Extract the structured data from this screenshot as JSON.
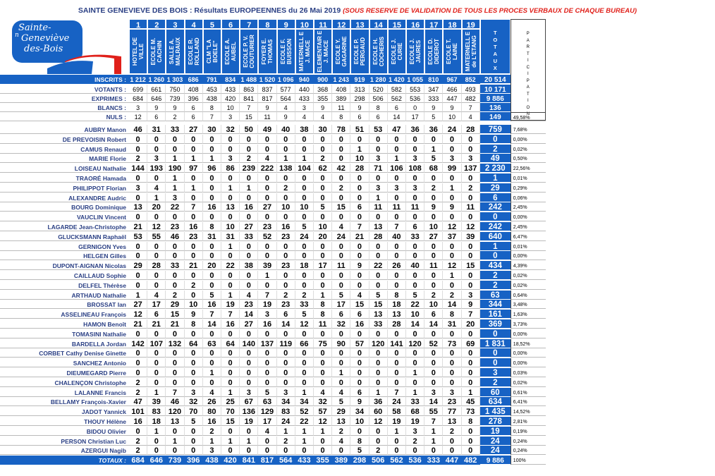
{
  "header": {
    "title_main": "SAINTE GENEVIEVE DES BOIS : Résultats EUROPEENNES du 26 Mai 2019",
    "title_note": "(SOUS RESERVE DE VALIDATION DE TOUS LES PROCES VERBAUX DE CHAQUE BUREAU)"
  },
  "logo": {
    "line1": "Sainte-",
    "line2": "Geneviève",
    "line3": "des-Bois",
    "prefix": "n"
  },
  "bureaux": [
    {
      "num": "1",
      "name": "HOTEL DE VILLE"
    },
    {
      "num": "2",
      "name": "ECOLE M. CACHIN"
    },
    {
      "num": "3",
      "name": "SALLE A. MALRAUX"
    },
    {
      "num": "4",
      "name": "ECOLE R. ROLLAND"
    },
    {
      "num": "5",
      "name": "CLM \"LA BOELE\""
    },
    {
      "num": "6",
      "name": "ECOLE A. AUBEL"
    },
    {
      "num": "7",
      "name": "ECOLE P. V. COUTURIER"
    },
    {
      "num": "8",
      "name": "FOYER E. THOMAS"
    },
    {
      "num": "9",
      "name": "ECOLE F. BUISSON"
    },
    {
      "num": "10",
      "name": "MATERNELL E J. MACE"
    },
    {
      "num": "11",
      "name": "ELEMENTAIR E J. MACE"
    },
    {
      "num": "12",
      "name": "ECOLE Y. GAGARINE"
    },
    {
      "num": "13",
      "name": "ECOLE P. PERGAUD"
    },
    {
      "num": "14",
      "name": "ECOLE H. COCHERIS"
    },
    {
      "num": "15",
      "name": "ECOLE J. CURIE"
    },
    {
      "num": "16",
      "name": "ECOLE J. JAURES"
    },
    {
      "num": "17",
      "name": "ECOLE D. DIDEROT"
    },
    {
      "num": "18",
      "name": "ECOLE T. LAINE"
    },
    {
      "num": "19",
      "name": "MATERNELL E de L'ETANG"
    }
  ],
  "totaux_header": "TOTAUX",
  "participation_header": "PARTICIPATION",
  "participation_value": "49,58%",
  "stats": [
    {
      "label": "INSCRITS :",
      "values": [
        "1 212",
        "1 260",
        "1 303",
        "686",
        "791",
        "834",
        "1 488",
        "1 520",
        "1 096",
        "940",
        "900",
        "1 243",
        "919",
        "1 280",
        "1 420",
        "1 055",
        "810",
        "967",
        "852"
      ],
      "total": "20 514"
    },
    {
      "label": "VOTANTS :",
      "values": [
        "699",
        "661",
        "750",
        "408",
        "453",
        "433",
        "863",
        "837",
        "577",
        "440",
        "368",
        "408",
        "313",
        "520",
        "582",
        "553",
        "347",
        "466",
        "493"
      ],
      "total": "10 171"
    },
    {
      "label": "EXPRIMES :",
      "values": [
        "684",
        "646",
        "739",
        "396",
        "438",
        "420",
        "841",
        "817",
        "564",
        "433",
        "355",
        "389",
        "298",
        "506",
        "562",
        "536",
        "333",
        "447",
        "482"
      ],
      "total": "9 886"
    },
    {
      "label": "BLANCS :",
      "values": [
        "3",
        "9",
        "9",
        "6",
        "8",
        "10",
        "7",
        "9",
        "4",
        "3",
        "9",
        "11",
        "9",
        "8",
        "6",
        "0",
        "9",
        "9",
        "7"
      ],
      "total": "136"
    },
    {
      "label": "NULS :",
      "values": [
        "12",
        "6",
        "2",
        "6",
        "7",
        "3",
        "15",
        "11",
        "9",
        "4",
        "4",
        "8",
        "6",
        "6",
        "14",
        "17",
        "5",
        "10",
        "4"
      ],
      "total": "149"
    }
  ],
  "candidates": [
    {
      "name": "AUBRY Manon",
      "values": [
        "46",
        "31",
        "33",
        "27",
        "30",
        "32",
        "50",
        "49",
        "40",
        "38",
        "30",
        "78",
        "51",
        "53",
        "47",
        "36",
        "36",
        "24",
        "28"
      ],
      "total": "759",
      "pct": "7,68%"
    },
    {
      "name": "DE PREVOISIN Robert",
      "values": [
        "0",
        "0",
        "0",
        "0",
        "0",
        "0",
        "0",
        "0",
        "0",
        "0",
        "0",
        "0",
        "0",
        "0",
        "0",
        "0",
        "0",
        "0",
        "0"
      ],
      "total": "0",
      "pct": "0,00%"
    },
    {
      "name": "CAMUS Renaud",
      "values": [
        "0",
        "0",
        "0",
        "0",
        "0",
        "0",
        "0",
        "0",
        "0",
        "0",
        "0",
        "0",
        "1",
        "0",
        "0",
        "0",
        "1",
        "0",
        "0"
      ],
      "total": "2",
      "pct": "0,02%"
    },
    {
      "name": "MARIE Florie",
      "values": [
        "2",
        "3",
        "1",
        "1",
        "1",
        "3",
        "2",
        "4",
        "1",
        "1",
        "2",
        "0",
        "10",
        "3",
        "1",
        "3",
        "5",
        "3",
        "3"
      ],
      "total": "49",
      "pct": "0,50%"
    },
    {
      "name": "LOISEAU Nathalie",
      "values": [
        "144",
        "193",
        "190",
        "97",
        "96",
        "86",
        "239",
        "222",
        "138",
        "104",
        "62",
        "42",
        "28",
        "71",
        "106",
        "108",
        "68",
        "99",
        "137"
      ],
      "total": "2 230",
      "pct": "22,56%"
    },
    {
      "name": "TRAORÉ Hamada",
      "values": [
        "0",
        "0",
        "1",
        "0",
        "0",
        "0",
        "0",
        "0",
        "0",
        "0",
        "0",
        "0",
        "0",
        "0",
        "0",
        "0",
        "0",
        "0",
        "0"
      ],
      "total": "1",
      "pct": "0,01%"
    },
    {
      "name": "PHILIPPOT Florian",
      "values": [
        "3",
        "4",
        "1",
        "1",
        "0",
        "1",
        "1",
        "0",
        "2",
        "0",
        "0",
        "2",
        "0",
        "3",
        "3",
        "3",
        "2",
        "1",
        "2"
      ],
      "total": "29",
      "pct": "0,29%"
    },
    {
      "name": "ALEXANDRE Audric",
      "values": [
        "0",
        "1",
        "3",
        "0",
        "0",
        "0",
        "0",
        "0",
        "0",
        "0",
        "0",
        "0",
        "0",
        "1",
        "0",
        "0",
        "0",
        "0",
        "0"
      ],
      "total": "6",
      "pct": "0,06%"
    },
    {
      "name": "BOURG Dominique",
      "values": [
        "13",
        "20",
        "22",
        "7",
        "16",
        "13",
        "16",
        "27",
        "10",
        "10",
        "5",
        "15",
        "6",
        "11",
        "11",
        "11",
        "9",
        "9",
        "11"
      ],
      "total": "242",
      "pct": "2,45%"
    },
    {
      "name": "VAUCLIN Vincent",
      "values": [
        "0",
        "0",
        "0",
        "0",
        "0",
        "0",
        "0",
        "0",
        "0",
        "0",
        "0",
        "0",
        "0",
        "0",
        "0",
        "0",
        "0",
        "0",
        "0"
      ],
      "total": "0",
      "pct": "0,00%"
    },
    {
      "name": "LAGARDE Jean-Christophe",
      "values": [
        "21",
        "12",
        "23",
        "16",
        "8",
        "10",
        "27",
        "23",
        "16",
        "5",
        "10",
        "4",
        "7",
        "13",
        "7",
        "6",
        "10",
        "12",
        "12"
      ],
      "total": "242",
      "pct": "2,45%"
    },
    {
      "name": "GLUCKSMANN Raphaël",
      "values": [
        "53",
        "55",
        "46",
        "23",
        "31",
        "31",
        "33",
        "52",
        "23",
        "24",
        "20",
        "24",
        "21",
        "28",
        "40",
        "33",
        "27",
        "37",
        "39"
      ],
      "total": "640",
      "pct": "6,47%"
    },
    {
      "name": "GERNIGON Yves",
      "values": [
        "0",
        "0",
        "0",
        "0",
        "0",
        "1",
        "0",
        "0",
        "0",
        "0",
        "0",
        "0",
        "0",
        "0",
        "0",
        "0",
        "0",
        "0",
        "0"
      ],
      "total": "1",
      "pct": "0,01%"
    },
    {
      "name": "HELGEN Gilles",
      "values": [
        "0",
        "0",
        "0",
        "0",
        "0",
        "0",
        "0",
        "0",
        "0",
        "0",
        "0",
        "0",
        "0",
        "0",
        "0",
        "0",
        "0",
        "0",
        "0"
      ],
      "total": "0",
      "pct": "0,00%"
    },
    {
      "name": "DUPONT-AIGNAN Nicolas",
      "values": [
        "29",
        "28",
        "33",
        "21",
        "20",
        "22",
        "38",
        "39",
        "23",
        "18",
        "17",
        "11",
        "9",
        "22",
        "26",
        "40",
        "11",
        "12",
        "15"
      ],
      "total": "434",
      "pct": "4,39%"
    },
    {
      "name": "CAILLAUD Sophie",
      "values": [
        "0",
        "0",
        "0",
        "0",
        "0",
        "0",
        "0",
        "1",
        "0",
        "0",
        "0",
        "0",
        "0",
        "0",
        "0",
        "0",
        "0",
        "1",
        "0"
      ],
      "total": "2",
      "pct": "0,02%"
    },
    {
      "name": "DELFEL Thérèse",
      "values": [
        "0",
        "0",
        "0",
        "2",
        "0",
        "0",
        "0",
        "0",
        "0",
        "0",
        "0",
        "0",
        "0",
        "0",
        "0",
        "0",
        "0",
        "0",
        "0"
      ],
      "total": "2",
      "pct": "0,02%"
    },
    {
      "name": "ARTHAUD Nathalie",
      "values": [
        "1",
        "4",
        "2",
        "0",
        "5",
        "1",
        "4",
        "7",
        "2",
        "2",
        "1",
        "5",
        "4",
        "5",
        "8",
        "5",
        "2",
        "2",
        "3"
      ],
      "total": "63",
      "pct": "0,64%"
    },
    {
      "name": "BROSSAT Ian",
      "values": [
        "27",
        "17",
        "29",
        "10",
        "16",
        "19",
        "23",
        "19",
        "23",
        "33",
        "8",
        "17",
        "15",
        "15",
        "18",
        "22",
        "10",
        "14",
        "9"
      ],
      "total": "344",
      "pct": "3,48%"
    },
    {
      "name": "ASSELINEAU François",
      "values": [
        "12",
        "6",
        "15",
        "9",
        "7",
        "7",
        "14",
        "3",
        "6",
        "5",
        "8",
        "6",
        "6",
        "13",
        "13",
        "10",
        "6",
        "8",
        "7"
      ],
      "total": "161",
      "pct": "1,63%"
    },
    {
      "name": "HAMON Benoît",
      "values": [
        "21",
        "21",
        "21",
        "8",
        "14",
        "16",
        "27",
        "16",
        "14",
        "12",
        "11",
        "32",
        "16",
        "33",
        "28",
        "14",
        "14",
        "31",
        "20"
      ],
      "total": "369",
      "pct": "3,73%"
    },
    {
      "name": "TOMASINI Nathalie",
      "values": [
        "0",
        "0",
        "0",
        "0",
        "0",
        "0",
        "0",
        "0",
        "0",
        "0",
        "0",
        "0",
        "0",
        "0",
        "0",
        "0",
        "0",
        "0",
        "0"
      ],
      "total": "0",
      "pct": "0,00%"
    },
    {
      "name": "BARDELLA Jordan",
      "values": [
        "142",
        "107",
        "132",
        "64",
        "63",
        "64",
        "140",
        "137",
        "119",
        "66",
        "75",
        "90",
        "57",
        "120",
        "141",
        "120",
        "52",
        "73",
        "69"
      ],
      "total": "1 831",
      "pct": "18,52%"
    },
    {
      "name": "CORBET Cathy Denise Ginette",
      "values": [
        "0",
        "0",
        "0",
        "0",
        "0",
        "0",
        "0",
        "0",
        "0",
        "0",
        "0",
        "0",
        "0",
        "0",
        "0",
        "0",
        "0",
        "0",
        "0"
      ],
      "total": "0",
      "pct": "0,00%"
    },
    {
      "name": "SANCHEZ Antonio",
      "values": [
        "0",
        "0",
        "0",
        "0",
        "0",
        "0",
        "0",
        "0",
        "0",
        "0",
        "0",
        "0",
        "0",
        "0",
        "0",
        "0",
        "0",
        "0",
        "0"
      ],
      "total": "0",
      "pct": "0,00%"
    },
    {
      "name": "DIEUMEGARD Pierre",
      "values": [
        "0",
        "0",
        "0",
        "0",
        "1",
        "0",
        "0",
        "0",
        "0",
        "0",
        "0",
        "1",
        "0",
        "0",
        "0",
        "1",
        "0",
        "0",
        "0"
      ],
      "total": "3",
      "pct": "0,03%"
    },
    {
      "name": "CHALENÇON Christophe",
      "values": [
        "2",
        "0",
        "0",
        "0",
        "0",
        "0",
        "0",
        "0",
        "0",
        "0",
        "0",
        "0",
        "0",
        "0",
        "0",
        "0",
        "0",
        "0",
        "0"
      ],
      "total": "2",
      "pct": "0,02%"
    },
    {
      "name": "LALANNE Francis",
      "values": [
        "2",
        "1",
        "7",
        "3",
        "4",
        "1",
        "3",
        "5",
        "3",
        "1",
        "4",
        "4",
        "6",
        "1",
        "7",
        "1",
        "3",
        "3",
        "1"
      ],
      "total": "60",
      "pct": "0,61%"
    },
    {
      "name": "BELLAMY François-Xavier",
      "values": [
        "47",
        "39",
        "46",
        "32",
        "26",
        "25",
        "67",
        "63",
        "34",
        "34",
        "32",
        "5",
        "9",
        "36",
        "24",
        "33",
        "14",
        "23",
        "45"
      ],
      "total": "634",
      "pct": "6,41%"
    },
    {
      "name": "JADOT Yannick",
      "values": [
        "101",
        "83",
        "120",
        "70",
        "80",
        "70",
        "136",
        "129",
        "83",
        "52",
        "57",
        "29",
        "34",
        "60",
        "58",
        "68",
        "55",
        "77",
        "73"
      ],
      "total": "1 435",
      "pct": "14,52%"
    },
    {
      "name": "THOUY Hélène",
      "values": [
        "16",
        "18",
        "13",
        "5",
        "16",
        "15",
        "19",
        "17",
        "24",
        "22",
        "12",
        "13",
        "10",
        "12",
        "19",
        "19",
        "7",
        "13",
        "8"
      ],
      "total": "278",
      "pct": "2,81%"
    },
    {
      "name": "BIDOU Olivier",
      "values": [
        "0",
        "1",
        "0",
        "0",
        "2",
        "0",
        "0",
        "4",
        "1",
        "1",
        "1",
        "2",
        "0",
        "0",
        "1",
        "3",
        "1",
        "2",
        "0"
      ],
      "total": "19",
      "pct": "0,19%"
    },
    {
      "name": "PERSON Christian Luc",
      "values": [
        "2",
        "0",
        "1",
        "0",
        "1",
        "1",
        "1",
        "0",
        "2",
        "1",
        "0",
        "4",
        "8",
        "0",
        "0",
        "2",
        "1",
        "0",
        "0"
      ],
      "total": "24",
      "pct": "0,24%"
    },
    {
      "name": "AZERGUI Nagib",
      "values": [
        "2",
        "0",
        "0",
        "0",
        "3",
        "0",
        "0",
        "0",
        "0",
        "0",
        "0",
        "0",
        "5",
        "2",
        "0",
        "0",
        "0",
        "0",
        "0"
      ],
      "total": "24",
      "pct": "0,24%"
    }
  ],
  "totaux_row": {
    "label": "TOTAUX :",
    "values": [
      "684",
      "646",
      "739",
      "396",
      "438",
      "420",
      "841",
      "817",
      "564",
      "433",
      "355",
      "389",
      "298",
      "506",
      "562",
      "536",
      "333",
      "447",
      "482"
    ],
    "total": "9 886",
    "pct": "100%"
  }
}
